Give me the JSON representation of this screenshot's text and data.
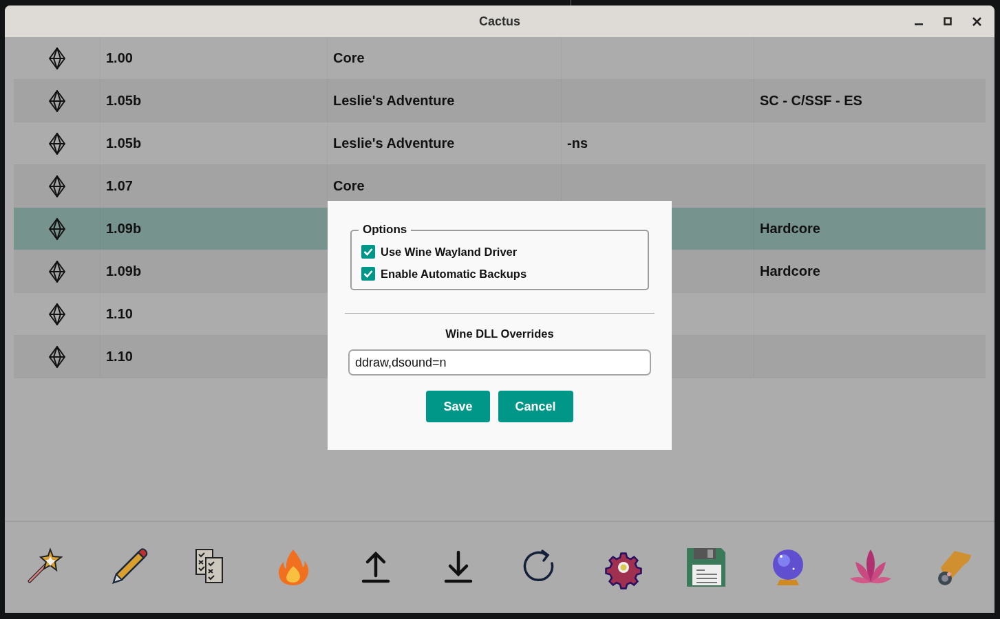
{
  "window": {
    "title": "Cactus"
  },
  "table": {
    "rows": [
      {
        "selected": false,
        "column_2": "1.00",
        "column_3": "Core"
      },
      {
        "selected": false,
        "column_2": "1.05b",
        "column_3": "Leslie's Adventure",
        "column_5": "SC - C/SSF - ES"
      },
      {
        "selected": false,
        "column_2": "1.05b",
        "column_3": "Leslie's Adventure",
        "column_4": "-ns"
      },
      {
        "selected": false,
        "column_2": "1.07",
        "column_3": "Core"
      },
      {
        "selected": true,
        "column_2": "1.09b",
        "column_5": "Hardcore"
      },
      {
        "selected": false,
        "column_2": "1.09b",
        "column_5": "Hardcore"
      },
      {
        "selected": false,
        "column_2": "1.10"
      },
      {
        "selected": false,
        "column_2": "1.10"
      }
    ]
  },
  "dialog": {
    "options": {
      "title": "Options",
      "checkboxes": [
        {
          "label": "Use Wine Wayland Driver",
          "checked": true
        },
        {
          "label": "Enable Automatic Backups",
          "checked": true
        }
      ]
    },
    "dll_overrides": {
      "label": "Wine DLL Overrides",
      "value": "ddraw,dsound=n"
    },
    "buttons": [
      "Save",
      "Cancel"
    ]
  }
}
